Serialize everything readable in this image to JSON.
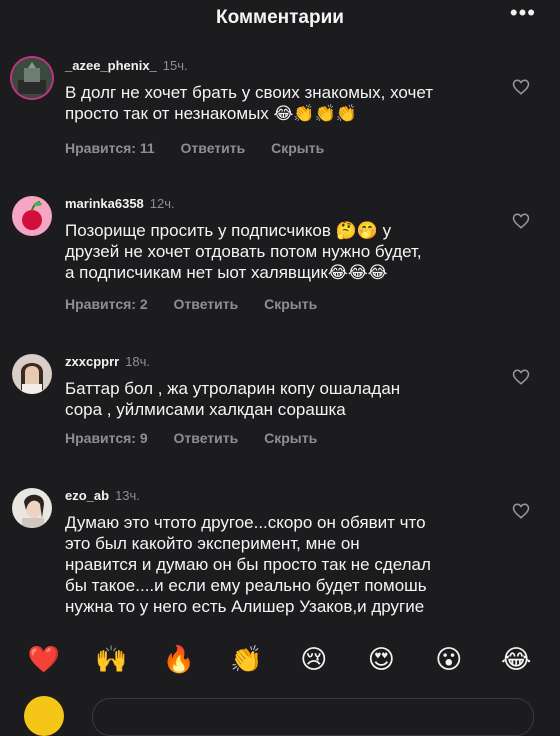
{
  "header": {
    "title": "Комментарии",
    "more_label": "•••"
  },
  "comments": [
    {
      "username": "_azee_phenix_",
      "time": "15ч.",
      "text": "В долг не хочет брать у своих знакомых, хочет\nпросто так от незнакомых 😂👏👏👏",
      "likes_label": "Нравится: 11",
      "reply_label": "Ответить",
      "hide_label": "Скрыть"
    },
    {
      "username": "marinka6358",
      "time": "12ч.",
      "text": "Позорище просить у подписчиков 🤔🤭 у\nдрузей не хочет отдовать потом нужно будет,\nа подписчикам нет ыот халявщик😂😂😂",
      "likes_label": "Нравится: 2",
      "reply_label": "Ответить",
      "hide_label": "Скрыть"
    },
    {
      "username": "zxxcpprr",
      "time": "18ч.",
      "text": "Баттар бол , жа утроларин копу ошаладан\nсора , уйлмисами халкдан сорашка",
      "likes_label": "Нравится: 9",
      "reply_label": "Ответить",
      "hide_label": "Скрыть"
    },
    {
      "username": "ezo_ab",
      "time": "13ч.",
      "text": "Думаю это чтото другое...скоро он обявит что\nэто был какойто эксперимент, мне он\nнравится и думаю он бы просто так не сделал\nбы такое....и если ему реально будет помошь\nнужна то  у него есть Алишер Узаков,и другие"
    }
  ],
  "emoji_bar": [
    "❤️",
    "🙌",
    "🔥",
    "👏",
    "😢",
    "😍",
    "😮",
    "😂"
  ]
}
